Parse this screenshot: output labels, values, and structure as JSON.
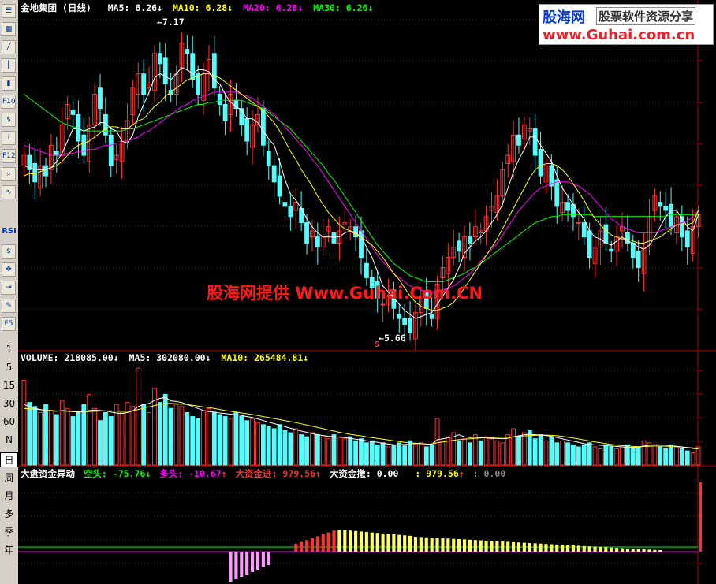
{
  "toolbar": {
    "text_items": [
      "RSI",
      "1",
      "5",
      "15",
      "30",
      "60",
      "N",
      "日",
      "周",
      "月",
      "多",
      "季",
      "年"
    ],
    "selected": "日",
    "icon_items": [
      "list-icon",
      "grid-icon",
      "line-chart-icon",
      "candle-icon",
      "bar-icon",
      "f10-icon",
      "stock-icon",
      "info-icon",
      "f12-icon",
      "zoom-icon",
      "indicator-icon",
      "dollar-icon",
      "move-icon",
      "export-icon",
      "pencil-icon",
      "f5-icon"
    ]
  },
  "price_panel": {
    "title": "金地集团 (日线)",
    "ma5_label": "MA5:",
    "ma5_value": "6.26",
    "ma10_label": "MA10:",
    "ma10_value": "6.28",
    "ma20_label": "MA20:",
    "ma20_value": "6.28",
    "ma30_label": "MA30:",
    "ma30_value": "6.26",
    "high_marker": "7.17",
    "low_marker": "5.66",
    "low_flag": "S"
  },
  "volume_panel": {
    "vol_label": "VOLUME:",
    "vol_value": "218085.00",
    "ma5_label": "MA5:",
    "ma5_value": "302080.00",
    "ma10_label": "MA10:",
    "ma10_value": "265484.81"
  },
  "fund_panel": {
    "title": "大盘资金异动",
    "short_label": "空头:",
    "short_value": "-75.76",
    "long_label": "多头:",
    "long_value": "-10.67",
    "inflow_label": "大资金进:",
    "inflow_value": "979.56",
    "outflow_label": "大资金撤:",
    "outflow_value": "0.00",
    "extra_label": ":",
    "extra_value": "979.56",
    "extra2_label": ":",
    "extra2_value": "0.00"
  },
  "watermark": "股海网提供 Www.Guhai.Com.CN",
  "logo": {
    "brand": "股海网",
    "tagline": "股票软件资源分享",
    "url": "www.Guhai.com.cn"
  },
  "colors": {
    "up": "#ff3333",
    "down": "#54fcfc",
    "ma5": "#ffffff",
    "ma10": "#ffff00",
    "ma20": "#ff00ff",
    "ma30": "#00ff00",
    "grid": "#b00000"
  },
  "chart_data": [
    {
      "type": "candlestick",
      "title": "金地集团 (日线)",
      "series": [
        {
          "name": "MA5",
          "last": 6.26
        },
        {
          "name": "MA10",
          "last": 6.28
        },
        {
          "name": "MA20",
          "last": 6.28
        },
        {
          "name": "MA30",
          "last": 6.26
        }
      ],
      "annotations": [
        {
          "label": "7.17",
          "kind": "high"
        },
        {
          "label": "5.66",
          "kind": "low"
        }
      ],
      "ylim": [
        5.6,
        7.25
      ],
      "close": [
        6.55,
        6.48,
        6.42,
        6.5,
        6.45,
        6.6,
        6.55,
        6.7,
        6.8,
        6.75,
        6.62,
        6.55,
        6.7,
        6.85,
        6.78,
        6.65,
        6.5,
        6.55,
        6.62,
        6.72,
        6.88,
        6.95,
        6.85,
        6.9,
        7.05,
        7.0,
        6.9,
        6.85,
        6.95,
        7.1,
        7.05,
        6.92,
        6.85,
        6.95,
        7.02,
        6.88,
        6.8,
        6.72,
        6.85,
        6.78,
        6.7,
        6.62,
        6.7,
        6.75,
        6.6,
        6.5,
        6.42,
        6.35,
        6.3,
        6.25,
        6.32,
        6.22,
        6.12,
        6.18,
        6.1,
        6.15,
        6.2,
        6.12,
        6.18,
        6.22,
        6.2,
        6.15,
        6.05,
        5.95,
        5.9,
        5.85,
        5.82,
        5.86,
        5.8,
        5.75,
        5.72,
        5.68,
        5.78,
        5.85,
        5.8,
        5.75,
        5.92,
        6.0,
        6.05,
        6.1,
        6.08,
        6.15,
        6.12,
        6.2,
        6.18,
        6.25,
        6.3,
        6.35,
        6.48,
        6.55,
        6.65,
        6.6,
        6.7,
        6.68,
        6.55,
        6.45,
        6.5,
        6.4,
        6.3,
        6.32,
        6.28,
        6.25,
        6.22,
        6.15,
        6.05,
        6.1,
        6.18,
        6.12,
        6.08,
        6.15,
        6.2,
        6.12,
        6.05,
        6.0,
        6.1,
        6.25,
        6.35,
        6.3,
        6.28,
        6.2,
        6.25,
        6.15,
        6.1,
        6.2,
        6.26
      ],
      "ma5": [
        6.5,
        6.49,
        6.48,
        6.48,
        6.48,
        6.49,
        6.52,
        6.56,
        6.62,
        6.68,
        6.68,
        6.67,
        6.68,
        6.69,
        6.71,
        6.71,
        6.68,
        6.67,
        6.62,
        6.61,
        6.65,
        6.74,
        6.8,
        6.86,
        6.93,
        6.95,
        6.94,
        6.92,
        6.95,
        6.98,
        6.97,
        6.95,
        6.97,
        6.97,
        6.96,
        6.92,
        6.9,
        6.85,
        6.81,
        6.79,
        6.77,
        6.73,
        6.73,
        6.71,
        6.67,
        6.63,
        6.6,
        6.52,
        6.43,
        6.36,
        6.33,
        6.29,
        6.24,
        6.2,
        6.17,
        6.15,
        6.15,
        6.15,
        6.15,
        6.17,
        6.18,
        6.17,
        6.15,
        6.1,
        6.05,
        5.98,
        5.91,
        5.88,
        5.85,
        5.82,
        5.79,
        5.77,
        5.75,
        5.76,
        5.77,
        5.78,
        5.82,
        5.86,
        5.9,
        5.94,
        6.0,
        6.07,
        6.1,
        6.13,
        6.15,
        6.18,
        6.22,
        6.26,
        6.31,
        6.39,
        6.47,
        6.53,
        6.58,
        6.64,
        6.64,
        6.6,
        6.56,
        6.52,
        6.45,
        6.39,
        6.35,
        6.31,
        6.27,
        6.24,
        6.18,
        6.15,
        6.14,
        6.12,
        6.11,
        6.13,
        6.15,
        6.13,
        6.12,
        6.1,
        6.09,
        6.11,
        6.15,
        6.2,
        6.25,
        6.28,
        6.28,
        6.24,
        6.2,
        6.18,
        6.26
      ],
      "ma10": [
        6.45,
        6.46,
        6.46,
        6.47,
        6.48,
        6.49,
        6.5,
        6.52,
        6.55,
        6.58,
        6.6,
        6.61,
        6.62,
        6.64,
        6.66,
        6.68,
        6.69,
        6.69,
        6.68,
        6.68,
        6.7,
        6.72,
        6.73,
        6.76,
        6.79,
        6.81,
        6.84,
        6.86,
        6.88,
        6.9,
        6.92,
        6.93,
        6.94,
        6.95,
        6.95,
        6.94,
        6.93,
        6.91,
        6.89,
        6.87,
        6.85,
        6.83,
        6.81,
        6.79,
        6.77,
        6.74,
        6.71,
        6.67,
        6.62,
        6.57,
        6.53,
        6.48,
        6.44,
        6.4,
        6.35,
        6.31,
        6.27,
        6.24,
        6.21,
        6.19,
        6.18,
        6.16,
        6.15,
        6.13,
        6.11,
        6.08,
        6.05,
        6.01,
        5.97,
        5.94,
        5.9,
        5.86,
        5.83,
        5.81,
        5.8,
        5.79,
        5.79,
        5.8,
        5.81,
        5.83,
        5.86,
        5.9,
        5.94,
        5.98,
        6.02,
        6.06,
        6.1,
        6.14,
        6.19,
        6.24,
        6.29,
        6.34,
        6.39,
        6.44,
        6.48,
        6.5,
        6.51,
        6.51,
        6.5,
        6.48,
        6.45,
        6.41,
        6.37,
        6.33,
        6.28,
        6.24,
        6.21,
        6.18,
        6.16,
        6.15,
        6.14,
        6.14,
        6.13,
        6.12,
        6.12,
        6.13,
        6.14,
        6.15,
        6.17,
        6.19,
        6.21,
        6.21,
        6.21,
        6.22,
        6.28
      ],
      "ma20": [
        6.6,
        6.59,
        6.58,
        6.57,
        6.56,
        6.55,
        6.55,
        6.55,
        6.56,
        6.56,
        6.57,
        6.57,
        6.58,
        6.58,
        6.59,
        6.6,
        6.6,
        6.61,
        6.61,
        6.62,
        6.63,
        6.64,
        6.66,
        6.67,
        6.69,
        6.71,
        6.73,
        6.75,
        6.77,
        6.79,
        6.8,
        6.82,
        6.83,
        6.84,
        6.85,
        6.86,
        6.86,
        6.86,
        6.86,
        6.86,
        6.85,
        6.84,
        6.83,
        6.81,
        6.79,
        6.77,
        6.75,
        6.72,
        6.69,
        6.66,
        6.63,
        6.6,
        6.57,
        6.53,
        6.5,
        6.46,
        6.42,
        6.38,
        6.34,
        6.3,
        6.26,
        6.22,
        6.18,
        6.14,
        6.1,
        6.06,
        6.03,
        6.0,
        5.97,
        5.95,
        5.93,
        5.91,
        5.9,
        5.89,
        5.88,
        5.88,
        5.88,
        5.89,
        5.9,
        5.91,
        5.93,
        5.95,
        5.97,
        6.0,
        6.03,
        6.06,
        6.09,
        6.12,
        6.16,
        6.2,
        6.24,
        6.28,
        6.31,
        6.34,
        6.37,
        6.39,
        6.4,
        6.41,
        6.42,
        6.42,
        6.42,
        6.41,
        6.4,
        6.38,
        6.36,
        6.33,
        6.3,
        6.27,
        6.24,
        6.22,
        6.2,
        6.19,
        6.18,
        6.17,
        6.17,
        6.17,
        6.17,
        6.18,
        6.19,
        6.2,
        6.21,
        6.22,
        6.23,
        6.25,
        6.28
      ],
      "ma30": [
        6.85,
        6.83,
        6.81,
        6.79,
        6.77,
        6.75,
        6.73,
        6.71,
        6.7,
        6.69,
        6.68,
        6.67,
        6.67,
        6.67,
        6.67,
        6.67,
        6.67,
        6.67,
        6.67,
        6.68,
        6.68,
        6.69,
        6.7,
        6.71,
        6.72,
        6.73,
        6.74,
        6.75,
        6.76,
        6.77,
        6.78,
        6.79,
        6.8,
        6.8,
        6.81,
        6.81,
        6.82,
        6.82,
        6.82,
        6.82,
        6.82,
        6.81,
        6.8,
        6.79,
        6.78,
        6.76,
        6.74,
        6.72,
        6.7,
        6.68,
        6.65,
        6.62,
        6.59,
        6.56,
        6.53,
        6.5,
        6.46,
        6.43,
        6.39,
        6.35,
        6.31,
        6.27,
        6.23,
        6.19,
        6.15,
        6.11,
        6.08,
        6.05,
        6.02,
        6.0,
        5.98,
        5.96,
        5.95,
        5.94,
        5.93,
        5.93,
        5.93,
        5.93,
        5.94,
        5.95,
        5.96,
        5.97,
        5.99,
        6.0,
        6.02,
        6.04,
        6.06,
        6.08,
        6.1,
        6.12,
        6.14,
        6.16,
        6.18,
        6.2,
        6.22,
        6.23,
        6.24,
        6.25,
        6.25,
        6.26,
        6.26,
        6.26,
        6.26,
        6.26,
        6.26,
        6.25,
        6.25,
        6.25,
        6.25,
        6.25,
        6.25,
        6.25,
        6.25,
        6.25,
        6.25,
        6.25,
        6.25,
        6.25,
        6.25,
        6.26,
        6.26,
        6.26,
        6.26,
        6.26,
        6.26
      ]
    },
    {
      "type": "bar",
      "title": "VOLUME",
      "series": [
        {
          "name": "VOLUME",
          "last": 218085.0
        },
        {
          "name": "MA5",
          "last": 302080.0
        },
        {
          "name": "MA10",
          "last": 265484.81
        }
      ],
      "ylim": [
        0,
        500000
      ],
      "values": [
        420000,
        310000,
        290000,
        260000,
        300000,
        270000,
        250000,
        320000,
        280000,
        240000,
        260000,
        300000,
        350000,
        280000,
        220000,
        260000,
        240000,
        300000,
        260000,
        310000,
        290000,
        480000,
        300000,
        260000,
        380000,
        310000,
        350000,
        280000,
        300000,
        290000,
        260000,
        240000,
        230000,
        270000,
        280000,
        260000,
        250000,
        240000,
        230000,
        260000,
        240000,
        220000,
        230000,
        210000,
        200000,
        190000,
        180000,
        200000,
        170000,
        160000,
        180000,
        150000,
        140000,
        160000,
        150000,
        140000,
        130000,
        150000,
        140000,
        130000,
        140000,
        120000,
        130000,
        110000,
        120000,
        100000,
        110000,
        90000,
        100000,
        110000,
        95000,
        120000,
        100000,
        110000,
        90000,
        100000,
        230000,
        120000,
        140000,
        160000,
        120000,
        130000,
        110000,
        150000,
        120000,
        140000,
        130000,
        120000,
        110000,
        150000,
        180000,
        140000,
        160000,
        170000,
        130000,
        150000,
        120000,
        140000,
        110000,
        120000,
        110000,
        100000,
        90000,
        100000,
        110000,
        90000,
        80000,
        100000,
        90000,
        80000,
        90000,
        100000,
        80000,
        90000,
        120000,
        110000,
        100000,
        90000,
        80000,
        100000,
        90000,
        80000,
        70000,
        60000,
        90000
      ],
      "ma5": [
        300000,
        290000,
        280000,
        275000,
        270000,
        268000,
        266000,
        270000,
        268000,
        265000,
        262000,
        265000,
        270000,
        272000,
        270000,
        268000,
        262000,
        258000,
        255000,
        260000,
        268000,
        290000,
        300000,
        305000,
        320000,
        330000,
        335000,
        318000,
        315000,
        310000,
        300000,
        290000,
        280000,
        270000,
        265000,
        262000,
        258000,
        255000,
        252000,
        250000,
        245000,
        240000,
        235000,
        228000,
        220000,
        212000,
        205000,
        198000,
        190000,
        182000,
        175000,
        168000,
        162000,
        156000,
        150000,
        146000,
        142000,
        140000,
        138000,
        136000,
        132000,
        128000,
        124000,
        120000,
        116000,
        112000,
        108000,
        104000,
        100000,
        100000,
        102000,
        104000,
        106000,
        106000,
        104000,
        103000,
        125000,
        130000,
        135000,
        140000,
        150000,
        140000,
        136000,
        138000,
        136000,
        134000,
        132000,
        132000,
        130000,
        132000,
        140000,
        145000,
        150000,
        152000,
        150000,
        148000,
        146000,
        142000,
        136000,
        130000,
        124000,
        118000,
        112000,
        106000,
        102000,
        100000,
        98000,
        96000,
        94000,
        92000,
        90000,
        88000,
        88000,
        88000,
        94000,
        98000,
        100000,
        100000,
        98000,
        96000,
        93000,
        90000,
        86000,
        82000,
        80000
      ],
      "ma10": [
        280000,
        278000,
        276000,
        274000,
        272000,
        270000,
        268000,
        267000,
        266000,
        265000,
        264000,
        264000,
        265000,
        266000,
        267000,
        268000,
        268000,
        267000,
        266000,
        266000,
        268000,
        275000,
        282000,
        288000,
        295000,
        300000,
        305000,
        305000,
        304000,
        302000,
        300000,
        296000,
        292000,
        288000,
        284000,
        280000,
        275000,
        270000,
        266000,
        262000,
        258000,
        254000,
        250000,
        245000,
        240000,
        235000,
        230000,
        225000,
        220000,
        215000,
        210000,
        204000,
        198000,
        192000,
        186000,
        180000,
        174000,
        168000,
        162000,
        157000,
        152000,
        148000,
        144000,
        140000,
        136000,
        132000,
        128000,
        124000,
        120000,
        116000,
        112000,
        110000,
        108000,
        106000,
        104000,
        104000,
        110000,
        114000,
        118000,
        122000,
        126000,
        128000,
        130000,
        132000,
        134000,
        136000,
        136000,
        137000,
        137000,
        138000,
        140000,
        142000,
        144000,
        146000,
        147000,
        148000,
        148000,
        147000,
        145000,
        142000,
        138000,
        134000,
        129000,
        124000,
        119000,
        114000,
        110000,
        106000,
        102000,
        99000,
        96000,
        94000,
        92000,
        91000,
        92000,
        93000,
        94000,
        94000,
        93000,
        92000,
        91000,
        89000,
        87000,
        85000,
        84000
      ]
    },
    {
      "type": "bar",
      "title": "大盘资金异动",
      "series": [
        {
          "name": "空头",
          "last": -75.76
        },
        {
          "name": "多头",
          "last": -10.67
        },
        {
          "name": "大资金进",
          "last": 979.56
        },
        {
          "name": "大资金撤",
          "last": 0.0
        }
      ],
      "ylim": [
        -100,
        1000
      ]
    }
  ]
}
